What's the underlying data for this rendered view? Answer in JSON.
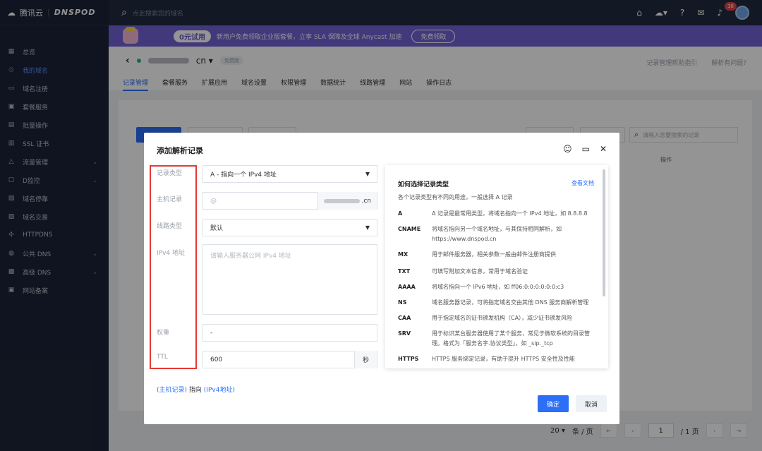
{
  "sidebar": {
    "logo_brand": "腾讯云",
    "logo_product": "DNSPOD",
    "items": [
      {
        "label": "总览",
        "icon": "grid-icon"
      },
      {
        "label": "我的域名",
        "icon": "globe-icon",
        "active": true
      },
      {
        "label": "域名注册",
        "icon": "register-icon"
      },
      {
        "label": "套餐服务",
        "icon": "package-icon"
      },
      {
        "label": "批量操作",
        "icon": "batch-icon"
      },
      {
        "label": "SSL 证书",
        "icon": "certificate-icon"
      },
      {
        "label": "流量管理",
        "icon": "traffic-icon",
        "has_children": true
      },
      {
        "label": "D监控",
        "icon": "monitor-icon",
        "has_children": true
      },
      {
        "label": "域名停靠",
        "icon": "parking-icon"
      },
      {
        "label": "域名交易",
        "icon": "trade-icon"
      },
      {
        "label": "HTTPDNS",
        "icon": "httpdns-icon"
      },
      {
        "label": "公共 DNS",
        "icon": "public-dns-icon",
        "has_children": true
      },
      {
        "label": "高级 DNS",
        "icon": "advanced-dns-icon",
        "has_children": true
      },
      {
        "label": "网站备案",
        "icon": "icp-icon"
      }
    ]
  },
  "topbar": {
    "search_placeholder": "点此搜索您的域名",
    "notification_count": "38"
  },
  "banner": {
    "pill": "0元试用",
    "text": "新用户免费领取企业版套餐，立享 SLA 保障及全球 Anycast 加速",
    "button": "免费领取"
  },
  "domain_header": {
    "domain_suffix": "cn ▾",
    "plan_tag": "免费版",
    "help_link": "记录管理帮助指引",
    "issue_link": "解析有问题?",
    "tabs": [
      "记录管理",
      "套餐服务",
      "扩展应用",
      "域名设置",
      "权限管理",
      "数据统计",
      "线路管理",
      "网站",
      "操作日志"
    ]
  },
  "background": {
    "search_placeholder": "请输入您要搜索的记录",
    "op_header": "操作"
  },
  "pager": {
    "page_size": "20 ▾",
    "per_page": "条 / 页",
    "current_page": "1",
    "total": "/ 1 页"
  },
  "modal": {
    "title": "添加解析记录",
    "labels": {
      "record_type": "记录类型",
      "host": "主机记录",
      "line": "线路类型",
      "ipv4": "IPv4 地址",
      "weight": "权重",
      "ttl": "TTL"
    },
    "record_type_value": "A - 指向一个 IPv4 地址",
    "host_placeholder": "@",
    "host_suffix": ".cn",
    "line_value": "默认",
    "ipv4_placeholder": "请输入服务器公网 IPv4 地址",
    "weight_value": "-",
    "ttl_value": "600",
    "ttl_unit": "秒",
    "hint_left": "(主机记录)",
    "hint_mid": "指向",
    "hint_right": "(IPv4地址)",
    "ok": "确定",
    "cancel": "取消"
  },
  "help": {
    "title": "如何选择记录类型",
    "doc_link": "查看文档",
    "desc": "各个记录类型有不同的用途，一般选择 A 记录",
    "rows": [
      {
        "k": "A",
        "v": "A 记录是最常用类型，将域名指向一个 IPv4 地址，如 8.8.8.8"
      },
      {
        "k": "CNAME",
        "v": "将域名指向另一个域名地址，与其保持相同解析，如 https://www.dnspod.cn"
      },
      {
        "k": "MX",
        "v": "用于邮件服务器，相关参数一般由邮件注册商提供"
      },
      {
        "k": "TXT",
        "v": "可填写附加文本信息，常用于域名验证"
      },
      {
        "k": "AAAA",
        "v": "将域名指向一个 IPv6 地址，如 ff06:0:0:0:0:0:0:c3"
      },
      {
        "k": "NS",
        "v": "域名服务器记录，可将指定域名交由其他 DNS 服务商解析管理"
      },
      {
        "k": "CAA",
        "v": "用于指定域名的证书颁发机构（CA），减少证书颁发风险"
      },
      {
        "k": "SRV",
        "v": "用于标识某台服务器使用了某个服务，常见于微软系统的目录管理。格式为「服务名字.协议类型」，如 _sip._tcp"
      },
      {
        "k": "HTTPS",
        "v": "HTTPS 服务绑定记录，有助于提升 HTTPS 安全性及性能"
      }
    ]
  },
  "colors": {
    "primary": "#2a6ff5",
    "sidebar_bg": "#1b2437",
    "banner_bg": "#7363d6",
    "highlight_red": "#e53935"
  }
}
